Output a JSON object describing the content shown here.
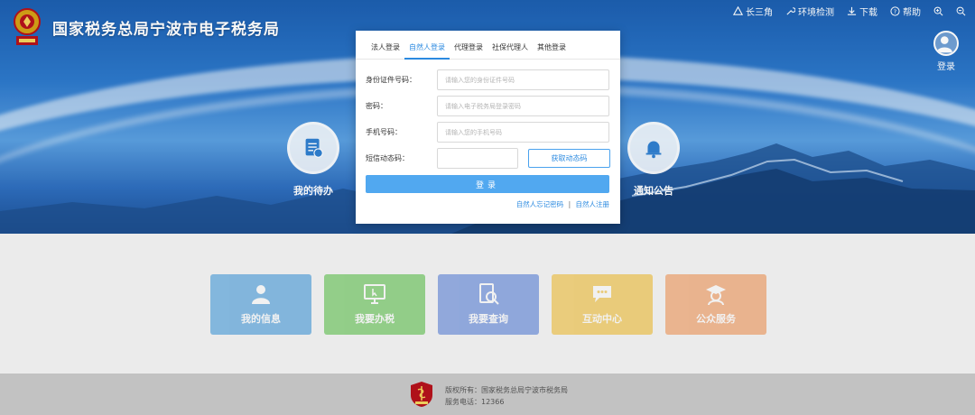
{
  "header": {
    "title": "国家税务总局宁波市电子税务局",
    "links": [
      {
        "label": "长三角",
        "icon": "triangle-icon"
      },
      {
        "label": "环境检测",
        "icon": "wrench-icon"
      },
      {
        "label": "下载",
        "icon": "download-icon"
      },
      {
        "label": "帮助",
        "icon": "help-icon"
      }
    ],
    "login_label": "登录"
  },
  "banner": {
    "left_item": "我的待办",
    "right_item": "通知公告"
  },
  "modal": {
    "tabs": [
      "法人登录",
      "自然人登录",
      "代理登录",
      "社保代理人",
      "其他登录"
    ],
    "active_tab": "自然人登录",
    "fields": {
      "id_label": "身份证件号码：",
      "id_placeholder": "请输入您的身份证件号码",
      "pwd_label": "密码：",
      "pwd_placeholder": "请输入电子税务局登录密码",
      "phone_label": "手机号码：",
      "phone_placeholder": "请输入您的手机号码",
      "sms_label": "短信动态码：",
      "sms_placeholder": ""
    },
    "get_code": "获取动态码",
    "login": "登录",
    "forgot": "自然人忘记密码",
    "separator": "|",
    "register": "自然人注册"
  },
  "tiles": [
    {
      "label": "我的信息",
      "color": "#2f8fd8",
      "icon": "person-icon"
    },
    {
      "label": "我要办税",
      "color": "#4dbb3b",
      "icon": "monitor-icon"
    },
    {
      "label": "我要查询",
      "color": "#4874d6",
      "icon": "document-search-icon"
    },
    {
      "label": "互动中心",
      "color": "#f0b820",
      "icon": "chat-icon"
    },
    {
      "label": "公众服务",
      "color": "#f08a45",
      "icon": "graduate-icon"
    }
  ],
  "footer": {
    "copyright": "版权所有：国家税务总局宁波市税务局",
    "phone": "服务电话：12366"
  }
}
